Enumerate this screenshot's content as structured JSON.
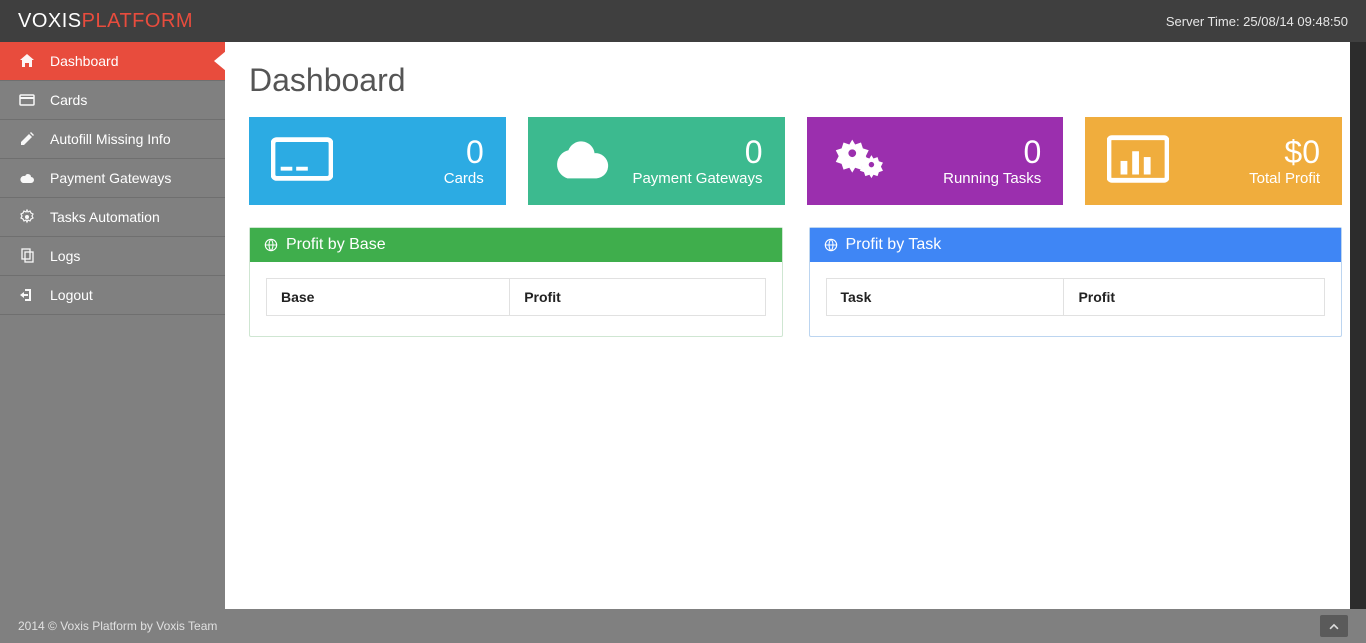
{
  "brand": {
    "part1": "VOXIS",
    "part2": "PLATFORM"
  },
  "server_time": {
    "prefix": "Server Time: ",
    "value": "25/08/14 09:48:50"
  },
  "sidebar": {
    "items": [
      {
        "label": "Dashboard",
        "icon": "home-icon",
        "active": true
      },
      {
        "label": "Cards",
        "icon": "card-icon",
        "active": false
      },
      {
        "label": "Autofill Missing Info",
        "icon": "edit-icon",
        "active": false
      },
      {
        "label": "Payment Gateways",
        "icon": "cloud-icon",
        "active": false
      },
      {
        "label": "Tasks Automation",
        "icon": "gears-icon",
        "active": false
      },
      {
        "label": "Logs",
        "icon": "copy-icon",
        "active": false
      },
      {
        "label": "Logout",
        "icon": "logout-icon",
        "active": false
      }
    ]
  },
  "page": {
    "title": "Dashboard"
  },
  "tiles": [
    {
      "value": "0",
      "label": "Cards",
      "color": "blue",
      "icon": "card-big-icon"
    },
    {
      "value": "0",
      "label": "Payment Gateways",
      "color": "green",
      "icon": "cloud-big-icon"
    },
    {
      "value": "0",
      "label": "Running Tasks",
      "color": "purple",
      "icon": "gears-big-icon"
    },
    {
      "value": "$0",
      "label": "Total Profit",
      "color": "orange",
      "icon": "chart-big-icon"
    }
  ],
  "panels": {
    "profit_by_base": {
      "title": "Profit by Base",
      "columns": [
        "Base",
        "Profit"
      ],
      "rows": []
    },
    "profit_by_task": {
      "title": "Profit by Task",
      "columns": [
        "Task",
        "Profit"
      ],
      "rows": []
    }
  },
  "footer": {
    "text": "2014 © Voxis Platform by Voxis Team"
  }
}
